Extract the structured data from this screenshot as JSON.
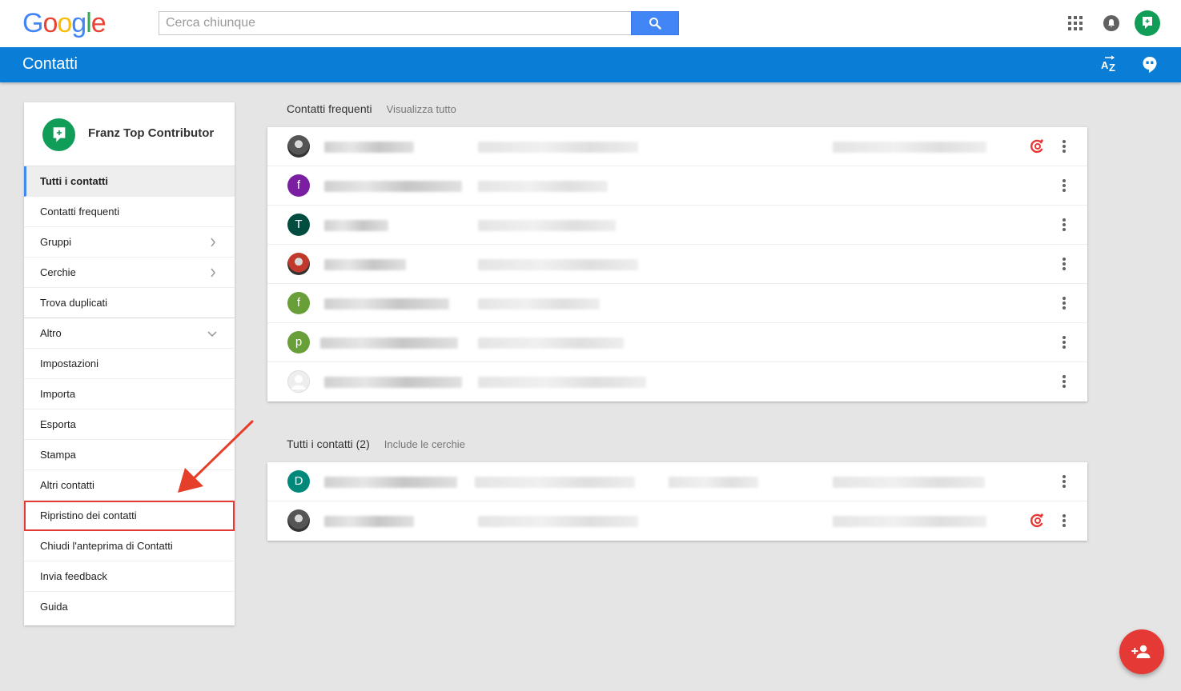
{
  "header": {
    "logo_letters": [
      {
        "ch": "G",
        "color": "#4285f4"
      },
      {
        "ch": "o",
        "color": "#ea4335"
      },
      {
        "ch": "o",
        "color": "#fbbc05"
      },
      {
        "ch": "g",
        "color": "#4285f4"
      },
      {
        "ch": "l",
        "color": "#34a853"
      },
      {
        "ch": "e",
        "color": "#ea4335"
      }
    ],
    "search_placeholder": "Cerca chiunque",
    "icons": [
      "search-icon",
      "apps-icon",
      "notifications-icon",
      "account-avatar"
    ]
  },
  "appbar": {
    "title": "Contatti",
    "sort_label": "AZ",
    "color": "#0a7ed6"
  },
  "sidebar": {
    "profile_name": "Franz Top Contributor",
    "items": [
      {
        "label": "Tutti i contatti"
      },
      {
        "label": "Contatti frequenti"
      },
      {
        "label": "Gruppi"
      },
      {
        "label": "Cerchie"
      },
      {
        "label": "Trova duplicati"
      },
      {
        "label": "Altro"
      },
      {
        "label": "Impostazioni"
      },
      {
        "label": "Importa"
      },
      {
        "label": "Esporta"
      },
      {
        "label": "Stampa"
      },
      {
        "label": "Altri contatti"
      },
      {
        "label": "Ripristino dei contatti"
      },
      {
        "label": "Chiudi l'anteprima di Contatti"
      },
      {
        "label": "Invia feedback"
      },
      {
        "label": "Guida"
      }
    ]
  },
  "frequent": {
    "title": "Contatti frequenti",
    "link": "Visualizza tutto",
    "rows": [
      {
        "avatar": "photo",
        "letter": "",
        "color": "#555555",
        "gplus": true
      },
      {
        "avatar": "letter",
        "letter": "f",
        "color": "#7b1fa2",
        "gplus": false
      },
      {
        "avatar": "letter",
        "letter": "T",
        "color": "#004d40",
        "gplus": false
      },
      {
        "avatar": "photo",
        "letter": "",
        "color": "#c0392b",
        "gplus": false
      },
      {
        "avatar": "letter",
        "letter": "f",
        "color": "#689f38",
        "gplus": false
      },
      {
        "avatar": "letter",
        "letter": "p",
        "color": "#689f38",
        "gplus": false
      },
      {
        "avatar": "blank",
        "letter": "",
        "color": "#e0e0e0",
        "gplus": false
      }
    ]
  },
  "all": {
    "title": "Tutti i contatti (2)",
    "link": "Include le cerchie",
    "rows": [
      {
        "avatar": "letter",
        "letter": "D",
        "color": "#00897b",
        "gplus": false
      },
      {
        "avatar": "photo",
        "letter": "",
        "color": "#555555",
        "gplus": true
      }
    ]
  },
  "colors": {
    "accent": "#4285f4",
    "fab": "#e53935",
    "highlight": "#e53935"
  }
}
